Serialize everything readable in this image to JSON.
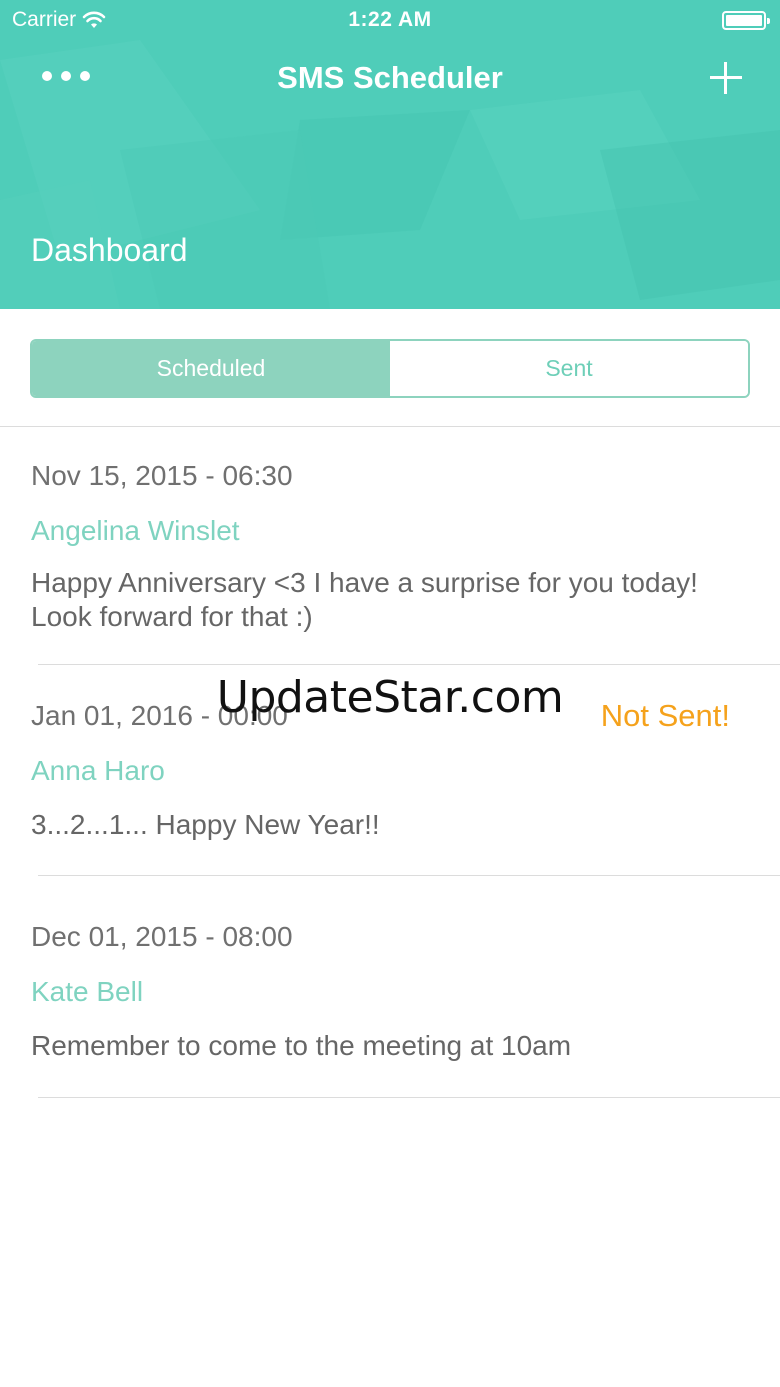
{
  "status_bar": {
    "carrier": "Carrier",
    "time": "1:22 AM"
  },
  "nav": {
    "title": "SMS Scheduler",
    "more_icon": "more-horizontal-icon",
    "add_icon": "plus-icon"
  },
  "page_title": "Dashboard",
  "tabs": [
    {
      "label": "Scheduled",
      "selected": true
    },
    {
      "label": "Sent",
      "selected": false
    }
  ],
  "messages": [
    {
      "date": "Nov 15, 2015 - 06:30",
      "recipient": "Angelina Winslet",
      "text": "Happy Anniversary <3 I have a surprise for you today! Look forward for that :)",
      "status": ""
    },
    {
      "date": "Jan 01, 2016 - 00:00",
      "recipient": "Anna Haro",
      "text": "3...2...1... Happy New Year!!",
      "status": "Not Sent!"
    },
    {
      "date": "Dec 01, 2015 - 08:00",
      "recipient": "Kate Bell",
      "text": "Remember to come to the meeting at 10am",
      "status": ""
    }
  ],
  "watermark": "UpdateStar.com",
  "colors": {
    "header": "#4fcdb9",
    "accent": "#8dd3be",
    "recipient": "#7fd3c0",
    "not_sent": "#f5a21c"
  }
}
